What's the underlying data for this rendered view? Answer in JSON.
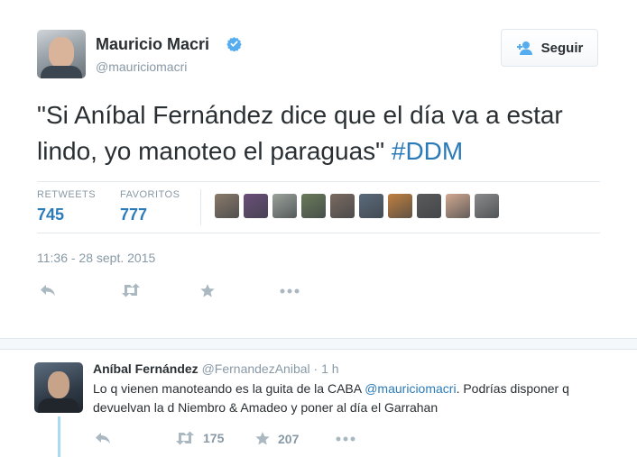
{
  "tweet": {
    "author_name": "Mauricio Macri",
    "author_handle": "@mauriciomacri",
    "verified_icon": "verified-badge-icon",
    "follow_label": "Seguir",
    "text": "\"Si Aníbal Fernández dice que el día va a estar lindo, yo manoteo el paraguas\"",
    "hashtag": "#DDM",
    "retweets_label": "RETWEETS",
    "retweets_count": "745",
    "favorites_label": "FAVORITOS",
    "favorites_count": "777",
    "timestamp": "11:36 - 28 sept. 2015",
    "favoriter_avatar_colors": [
      "#8a7a6a",
      "#6b4e7a",
      "#9aa29a",
      "#6a7a5a",
      "#7a6a60",
      "#5a6a7a",
      "#c08040",
      "#5a5a5a",
      "#d0a890",
      "#8a8a8a"
    ],
    "actions": [
      "reply-icon",
      "retweet-icon",
      "favorite-icon",
      "more-icon"
    ]
  },
  "reply": {
    "author_name": "Aníbal Fernández",
    "author_handle": "@FernandezAnibal",
    "separator": "·",
    "time": "1 h",
    "text_before": "Lo q vienen manoteando es la guita de la CABA ",
    "mention": "@mauriciomacri",
    "text_after": ". Podrías disponer q devuelvan la d Niembro & Amadeo y poner al día el Garrahan",
    "retweets_count": "175",
    "favorites_count": "207"
  },
  "colors": {
    "link": "#2b7bb9",
    "muted": "#8899a6",
    "text": "#292f33",
    "thread_line": "#a7dcf3",
    "border": "#e1e8ed"
  }
}
